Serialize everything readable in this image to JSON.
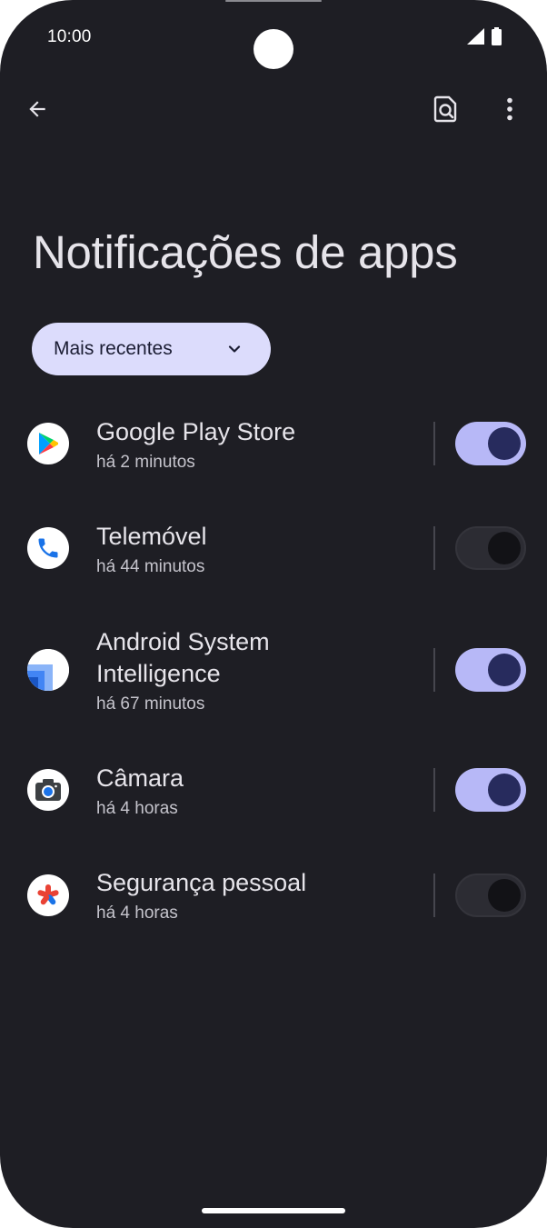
{
  "status_bar": {
    "time": "10:00"
  },
  "toolbar": {
    "back_icon": "arrow-left-icon",
    "search_icon": "search-settings-icon",
    "more_icon": "more-vert-icon"
  },
  "page": {
    "title": "Notificações de apps"
  },
  "filter": {
    "selected": "Mais recentes"
  },
  "apps": [
    {
      "name": "Google Play Store",
      "time": "há 2 minutos",
      "enabled": true,
      "icon": "google-play-icon"
    },
    {
      "name": "Telemóvel",
      "time": "há 44 minutos",
      "enabled": false,
      "icon": "phone-icon"
    },
    {
      "name_line1": "Android System",
      "name_line2": "Intelligence",
      "time": "há 67 minutos",
      "enabled": true,
      "icon": "android-system-intelligence-icon"
    },
    {
      "name": "Câmara",
      "time": "há 4 horas",
      "enabled": true,
      "icon": "camera-icon"
    },
    {
      "name": "Segurança pessoal",
      "time": "há 4 horas",
      "enabled": false,
      "icon": "personal-safety-icon"
    }
  ],
  "colors": {
    "background": "#1e1e24",
    "chip": "#dcdcfc",
    "switch_on_track": "#b7b8f7",
    "switch_on_thumb": "#272b5d",
    "switch_off_track": "#2c2c33"
  }
}
